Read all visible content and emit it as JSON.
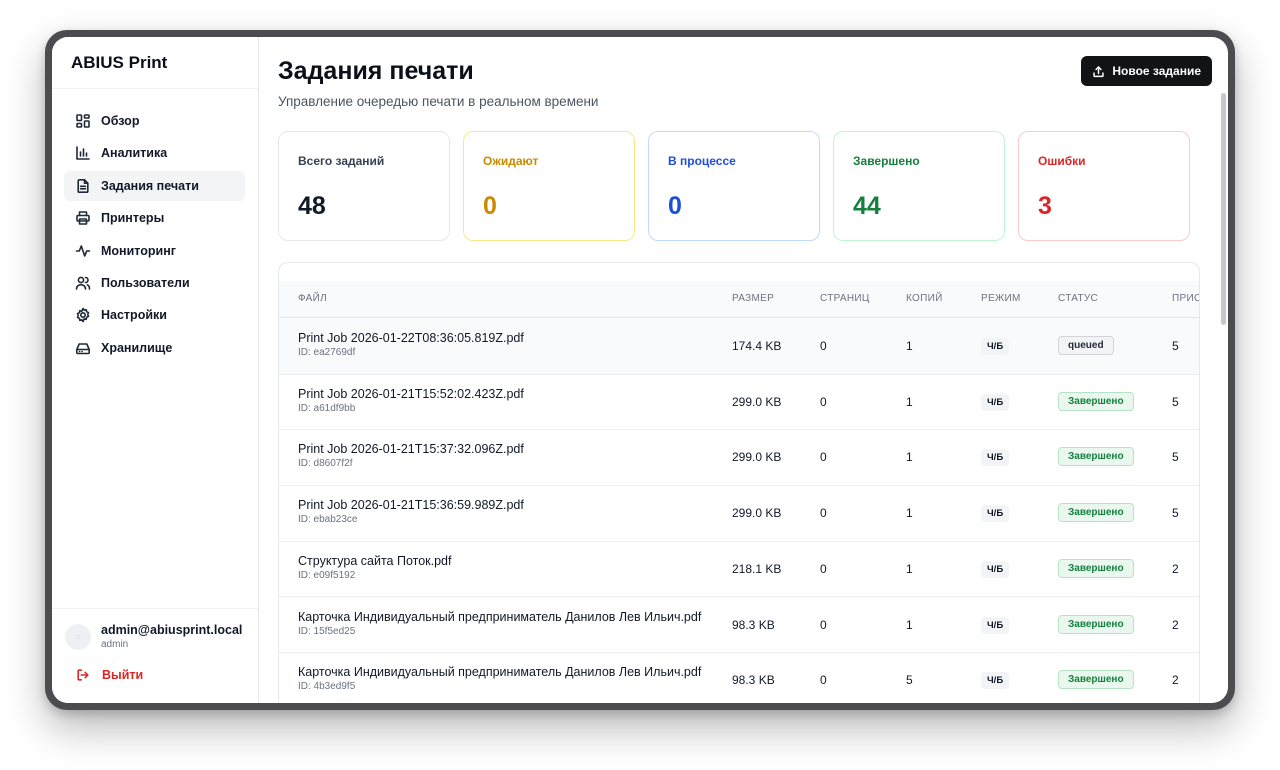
{
  "app": {
    "brand": "ABIUS Print"
  },
  "sidebar": {
    "items": [
      {
        "label": "Обзор",
        "icon": "grid-icon",
        "active": false
      },
      {
        "label": "Аналитика",
        "icon": "bar-chart-icon",
        "active": false
      },
      {
        "label": "Задания печати",
        "icon": "file-text-icon",
        "active": true
      },
      {
        "label": "Принтеры",
        "icon": "printer-icon",
        "active": false
      },
      {
        "label": "Мониторинг",
        "icon": "activity-icon",
        "active": false
      },
      {
        "label": "Пользователи",
        "icon": "users-icon",
        "active": false
      },
      {
        "label": "Настройки",
        "icon": "gear-icon",
        "active": false
      },
      {
        "label": "Хранилище",
        "icon": "hard-drive-icon",
        "active": false
      }
    ],
    "user": {
      "email": "admin@abiusprint.local",
      "role": "admin"
    },
    "logout_label": "Выйти"
  },
  "header": {
    "title": "Задания печати",
    "subtitle": "Управление очередью печати в реальном времени",
    "new_job_label": "Новое задание"
  },
  "stats": [
    {
      "label": "Всего заданий",
      "value": "48",
      "color": "#111827",
      "border": "#e5e7eb"
    },
    {
      "label": "Ожидают",
      "value": "0",
      "color": "#ca8a04",
      "border": "#fde68a"
    },
    {
      "label": "В процессе",
      "value": "0",
      "color": "#1d4ed8",
      "border": "#bfdbfe"
    },
    {
      "label": "Завершено",
      "value": "44",
      "color": "#15803d",
      "border": "#bbf7d0"
    },
    {
      "label": "Ошибки",
      "value": "3",
      "color": "#dc2626",
      "border": "#fecaca"
    }
  ],
  "table": {
    "columns": [
      "ФАЙЛ",
      "РАЗМЕР",
      "СТРАНИЦ",
      "КОПИЙ",
      "РЕЖИМ",
      "СТАТУС",
      "ПРИС"
    ],
    "rows": [
      {
        "file": "Print Job 2026-01-22T08:36:05.819Z.pdf",
        "id": "ID: ea2769df",
        "size": "174.4 KB",
        "pages": "0",
        "copies": "1",
        "mode": "Ч/Б",
        "status": "queued",
        "status_type": "queued",
        "priority": "5"
      },
      {
        "file": "Print Job 2026-01-21T15:52:02.423Z.pdf",
        "id": "ID: a61df9bb",
        "size": "299.0 KB",
        "pages": "0",
        "copies": "1",
        "mode": "Ч/Б",
        "status": "Завершено",
        "status_type": "done",
        "priority": "5"
      },
      {
        "file": "Print Job 2026-01-21T15:37:32.096Z.pdf",
        "id": "ID: d8607f2f",
        "size": "299.0 KB",
        "pages": "0",
        "copies": "1",
        "mode": "Ч/Б",
        "status": "Завершено",
        "status_type": "done",
        "priority": "5"
      },
      {
        "file": "Print Job 2026-01-21T15:36:59.989Z.pdf",
        "id": "ID: ebab23ce",
        "size": "299.0 KB",
        "pages": "0",
        "copies": "1",
        "mode": "Ч/Б",
        "status": "Завершено",
        "status_type": "done",
        "priority": "5"
      },
      {
        "file": "Структура сайта Поток.pdf",
        "id": "ID: e09f5192",
        "size": "218.1 KB",
        "pages": "0",
        "copies": "1",
        "mode": "Ч/Б",
        "status": "Завершено",
        "status_type": "done",
        "priority": "2"
      },
      {
        "file": "Карточка Индивидуальный предприниматель Данилов Лев Ильич.pdf",
        "id": "ID: 15f5ed25",
        "size": "98.3 KB",
        "pages": "0",
        "copies": "1",
        "mode": "Ч/Б",
        "status": "Завершено",
        "status_type": "done",
        "priority": "2"
      },
      {
        "file": "Карточка Индивидуальный предприниматель Данилов Лев Ильич.pdf",
        "id": "ID: 4b3ed9f5",
        "size": "98.3 KB",
        "pages": "0",
        "copies": "5",
        "mode": "Ч/Б",
        "status": "Завершено",
        "status_type": "done",
        "priority": "2"
      }
    ]
  }
}
